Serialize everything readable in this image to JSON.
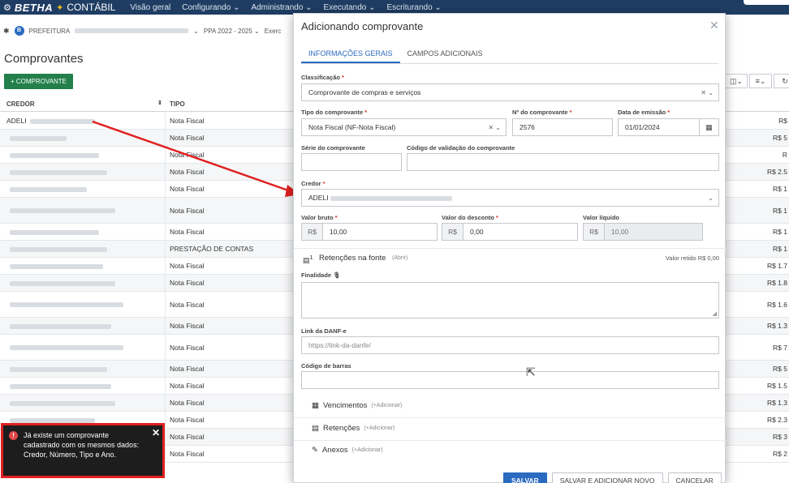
{
  "topnav": {
    "brand": "BETHA",
    "product": "CONTÁBIL",
    "menu": [
      "Visão geral",
      "Configurando ⌄",
      "Administrando ⌄",
      "Executando ⌄",
      "Escriturando ⌄"
    ]
  },
  "context": {
    "entity_badge": "B",
    "entity": "PREFEITURA",
    "ppa": "PPA 2022 - 2025 ⌄",
    "exercise": "Exerc"
  },
  "page": {
    "title": "Comprovantes",
    "add_button": "+ COMPROVANTE"
  },
  "table": {
    "headers": {
      "credor": "CREDOR",
      "tipo": "TIPO"
    },
    "rows": [
      {
        "credor": "ADELI",
        "tipo": "Nota Fiscal",
        "valor": "R$"
      },
      {
        "credor": "",
        "tipo": "Nota Fiscal",
        "valor": "R$ 5"
      },
      {
        "credor": "",
        "tipo": "Nota Fiscal",
        "valor": "R"
      },
      {
        "credor": "",
        "tipo": "Nota Fiscal",
        "valor": "R$ 2.5"
      },
      {
        "credor": "",
        "tipo": "Nota Fiscal",
        "valor": "R$ 1"
      },
      {
        "credor": "",
        "tipo": "Nota Fiscal",
        "valor": "R$ 1"
      },
      {
        "credor": "",
        "tipo": "Nota Fiscal",
        "valor": "R$ 1"
      },
      {
        "credor": "",
        "tipo": "PRESTAÇÃO DE CONTAS",
        "valor": "R$ 1"
      },
      {
        "credor": "",
        "tipo": "Nota Fiscal",
        "valor": "R$ 1.7"
      },
      {
        "credor": "",
        "tipo": "Nota Fiscal",
        "valor": "R$ 1.8"
      },
      {
        "credor": "",
        "tipo": "Nota Fiscal",
        "valor": "R$ 1.6"
      },
      {
        "credor": "",
        "tipo": "Nota Fiscal",
        "valor": "R$ 1.3"
      },
      {
        "credor": "",
        "tipo": "Nota Fiscal",
        "valor": "R$ 7"
      },
      {
        "credor": "",
        "tipo": "Nota Fiscal",
        "valor": "R$ 5"
      },
      {
        "credor": "",
        "tipo": "Nota Fiscal",
        "valor": "R$ 1.5"
      },
      {
        "credor": "",
        "tipo": "Nota Fiscal",
        "valor": "R$ 1.3"
      },
      {
        "credor": "",
        "tipo": "Nota Fiscal",
        "valor": "R$ 2.3"
      },
      {
        "credor": "",
        "tipo": "Nota Fiscal",
        "valor": "R$ 3"
      },
      {
        "credor": "",
        "tipo": "Nota Fiscal",
        "valor": "R$ 2"
      }
    ]
  },
  "modal": {
    "title": "Adicionando comprovante",
    "tabs": [
      "INFORMAÇÕES GERAIS",
      "CAMPOS ADICIONAIS"
    ],
    "classificacao": {
      "label": "Classificação",
      "value": "Comprovante de compras e serviços"
    },
    "tipo": {
      "label": "Tipo do comprovante",
      "value": "Nota Fiscal (NF-Nota Fiscal)"
    },
    "numero": {
      "label": "Nº do comprovante",
      "value": "2576"
    },
    "data": {
      "label": "Data de emissão",
      "value": "01/01/2024"
    },
    "serie": {
      "label": "Série do comprovante",
      "value": ""
    },
    "codigo_validacao": {
      "label": "Código de validação do comprovante",
      "value": ""
    },
    "credor": {
      "label": "Credor",
      "value": "ADELI"
    },
    "valor_bruto": {
      "label": "Valor bruto",
      "prefix": "R$",
      "value": "10,00"
    },
    "valor_desconto": {
      "label": "Valor do desconto",
      "prefix": "R$",
      "value": "0,00"
    },
    "valor_liquido": {
      "label": "Valor líquido",
      "prefix": "R$",
      "value": "10,00"
    },
    "retencoes_fonte": {
      "label": "Retenções na fonte",
      "badge": "1",
      "action": "(Abrir)",
      "valor_retido": "Valor retido R$ 0,00"
    },
    "finalidade": {
      "label": "Finalidade"
    },
    "link_danfe": {
      "label": "Link da DANF-e",
      "placeholder": "https://link-da-danfe/"
    },
    "codigo_barras": {
      "label": "Código de barras",
      "value": ""
    },
    "sections": [
      {
        "label": "Vencimentos",
        "action": "(+Adicionar)"
      },
      {
        "label": "Retenções",
        "action": "(+Adicionar)"
      },
      {
        "label": "Anexos",
        "action": "(+Adicionar)"
      }
    ],
    "buttons": {
      "save": "SALVAR",
      "save_new": "SALVAR E ADICIONAR NOVO",
      "cancel": "CANCELAR"
    }
  },
  "toast": {
    "message": "Já existe um comprovante cadastrado com os mesmos dados: Credor, Número, Tipo e Ano.",
    "close": "✕"
  },
  "colors": {
    "nav": "#1f3d63",
    "primary": "#2a6ac0",
    "success": "#23804a",
    "annotation": "#e02020"
  }
}
